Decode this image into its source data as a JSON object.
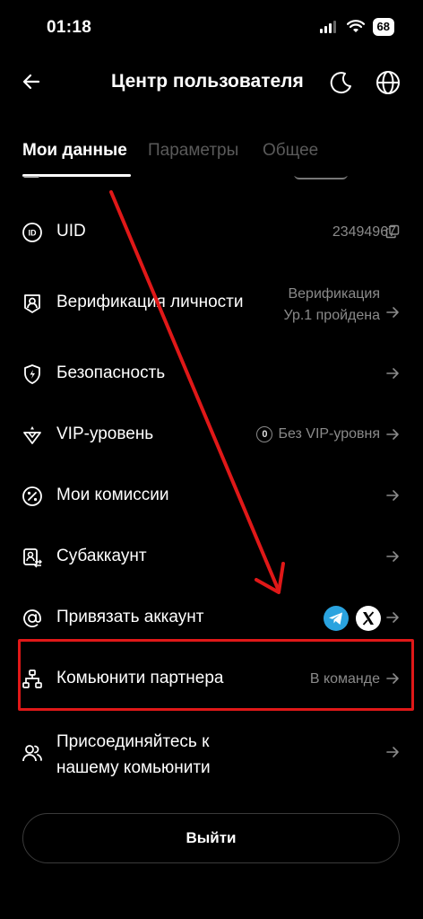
{
  "status_bar": {
    "time": "01:18",
    "battery": "68"
  },
  "header": {
    "title": "Центр пользователя"
  },
  "tabs": [
    {
      "label": "Мои данные",
      "active": true
    },
    {
      "label": "Параметры",
      "active": false
    },
    {
      "label": "Общее",
      "active": false
    }
  ],
  "rows": {
    "uid": {
      "label": "UID",
      "value": "23494967"
    },
    "verification": {
      "label": "Верификация личности",
      "value_line1": "Верификация",
      "value_line2": "Ур.1 пройдена"
    },
    "security": {
      "label": "Безопасность"
    },
    "vip": {
      "label": "VIP-уровень",
      "badge": "0",
      "value": "Без VIP-уровня"
    },
    "commissions": {
      "label": "Мои комиссии"
    },
    "subaccount": {
      "label": "Субаккаунт"
    },
    "link_account": {
      "label": "Привязать аккаунт",
      "services": [
        "telegram",
        "x"
      ]
    },
    "partner_community": {
      "label": "Комьюнити партнера",
      "value": "В команде"
    },
    "join_community": {
      "label_line1": "Присоединяйтесь к",
      "label_line2": "нашему комьюнити"
    }
  },
  "logout_label": "Выйти",
  "colors": {
    "background": "#000000",
    "muted": "#8a8a8a",
    "annotation": "#e01818",
    "telegram": "#2aa3df"
  }
}
